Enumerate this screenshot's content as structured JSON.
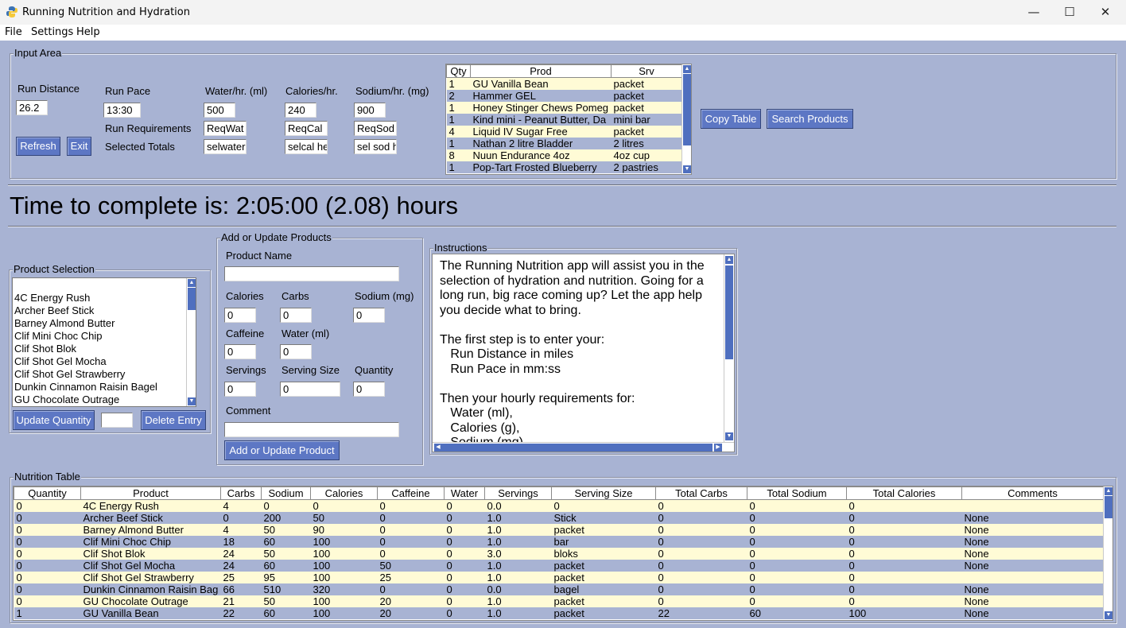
{
  "window": {
    "title": "Running Nutrition and Hydration",
    "minimize": "—",
    "maximize": "☐",
    "close": "✕"
  },
  "menu": {
    "file": "File",
    "settings": "Settings",
    "help": "Help"
  },
  "input_area": {
    "title": "Input Area",
    "run_distance_label": "Run Distance",
    "run_distance_value": "26.2",
    "run_pace_label": "Run Pace",
    "run_pace_value": "13:30",
    "water_label": "Water/hr. (ml)",
    "water_value": "500",
    "calories_label": "Calories/hr.",
    "calories_value": "240",
    "sodium_label": "Sodium/hr. (mg)",
    "sodium_value": "900",
    "run_requirements_label": "Run Requirements",
    "req_water": "ReqWat",
    "req_cal": "ReqCal",
    "req_sod": "ReqSod",
    "selected_totals_label": "Selected Totals",
    "sel_water": "selwater",
    "sel_cal": "selcal he",
    "sel_sod": "sel sod h",
    "refresh_label": "Refresh",
    "exit_label": "Exit",
    "copy_table_label": "Copy Table",
    "search_products_label": "Search Products",
    "selected_table": {
      "headers": [
        "Qty",
        "Prod",
        "Srv"
      ],
      "rows": [
        [
          "1",
          "GU Vanilla Bean",
          "packet"
        ],
        [
          "2",
          "Hammer GEL",
          "packet"
        ],
        [
          "1",
          "Honey Stinger Chews Pomeg",
          "packet"
        ],
        [
          "1",
          "Kind mini - Peanut Butter, Da",
          "mini bar"
        ],
        [
          "4",
          "Liquid IV Sugar Free",
          "packet"
        ],
        [
          "1",
          "Nathan 2 litre Bladder",
          "2 litres"
        ],
        [
          "8",
          "Nuun Endurance 4oz",
          "4oz cup"
        ],
        [
          "1",
          "Pop-Tart Frosted Blueberry",
          "2 pastries"
        ]
      ]
    }
  },
  "time_to_complete": "Time to complete is: 2:05:00 (2.08) hours",
  "product_selection": {
    "title": "Product Selection",
    "items": [
      "",
      "4C Energy Rush",
      "Archer Beef Stick",
      "Barney Almond Butter",
      "Clif Mini Choc Chip",
      "Clif Shot Blok",
      "Clif Shot Gel Mocha",
      "Clif Shot Gel Strawberry",
      "Dunkin Cinnamon Raisin Bagel",
      "GU Chocolate Outrage"
    ],
    "update_quantity_label": "Update Quantity",
    "quantity_value": "",
    "delete_entry_label": "Delete Entry"
  },
  "add_update": {
    "title": "Add or Update Products",
    "product_name_label": "Product Name",
    "product_name_value": "",
    "calories_label": "Calories",
    "calories_value": "0",
    "carbs_label": "Carbs",
    "carbs_value": "0",
    "sodium_label": "Sodium (mg)",
    "sodium_value": "0",
    "caffeine_label": "Caffeine",
    "caffeine_value": "0",
    "water_label": "Water (ml)",
    "water_value": "0",
    "servings_label": "Servings",
    "servings_value": "0",
    "serving_size_label": "Serving Size",
    "serving_size_value": "0",
    "quantity_label": "Quantity",
    "quantity_value": "0",
    "comment_label": "Comment",
    "comment_value": "",
    "submit_label": "Add or Update Product"
  },
  "instructions": {
    "title": "Instructions",
    "text": "The Running Nutrition app will assist you in the\nselection of hydration and nutrition. Going for a\nlong run, big race coming up? Let the app help\nyou decide what to bring.\n\nThe first step is to enter your:\n   Run Distance in miles\n   Run Pace in mm:ss\n\nThen your hourly requirements for:\n   Water (ml),\n   Calories (g),\n   Sodium (mg)"
  },
  "nutrition_table": {
    "title": "Nutrition Table",
    "headers": [
      "Quantity",
      "Product",
      "Carbs",
      "Sodium",
      "Calories",
      "Caffeine",
      "Water",
      "Servings",
      "Serving Size",
      "Total Carbs",
      "Total Sodium",
      "Total Calories",
      "Comments"
    ],
    "rows": [
      [
        "0",
        "4C Energy Rush",
        "4",
        "0",
        "0",
        "0",
        "0",
        "0.0",
        "0",
        "0",
        "0",
        "0",
        ""
      ],
      [
        "0",
        "Archer Beef Stick",
        "0",
        "200",
        "50",
        "0",
        "0",
        "1.0",
        "Stick",
        "0",
        "0",
        "0",
        "None"
      ],
      [
        "0",
        "Barney Almond Butter",
        "4",
        "50",
        "90",
        "0",
        "0",
        "1.0",
        "packet",
        "0",
        "0",
        "0",
        "None"
      ],
      [
        "0",
        "Clif Mini Choc Chip",
        "18",
        "60",
        "100",
        "0",
        "0",
        "1.0",
        "bar",
        "0",
        "0",
        "0",
        "None"
      ],
      [
        "0",
        "Clif Shot Blok",
        "24",
        "50",
        "100",
        "0",
        "0",
        "3.0",
        "bloks",
        "0",
        "0",
        "0",
        "None"
      ],
      [
        "0",
        "Clif Shot Gel Mocha",
        "24",
        "60",
        "100",
        "50",
        "0",
        "1.0",
        "packet",
        "0",
        "0",
        "0",
        "None"
      ],
      [
        "0",
        "Clif Shot Gel Strawberry",
        "25",
        "95",
        "100",
        "25",
        "0",
        "1.0",
        "packet",
        "0",
        "0",
        "0",
        ""
      ],
      [
        "0",
        "Dunkin Cinnamon Raisin Bag",
        "66",
        "510",
        "320",
        "0",
        "0",
        "0.0",
        "bagel",
        "0",
        "0",
        "0",
        "None"
      ],
      [
        "0",
        "GU Chocolate Outrage",
        "21",
        "50",
        "100",
        "20",
        "0",
        "1.0",
        "packet",
        "0",
        "0",
        "0",
        "None"
      ],
      [
        "1",
        "GU Vanilla Bean",
        "22",
        "60",
        "100",
        "20",
        "0",
        "1.0",
        "packet",
        "22",
        "60",
        "100",
        "None"
      ]
    ]
  },
  "colors": {
    "background": "#a8b3d3",
    "button": "#5d77c4",
    "row_highlight": "#fffbd6"
  }
}
